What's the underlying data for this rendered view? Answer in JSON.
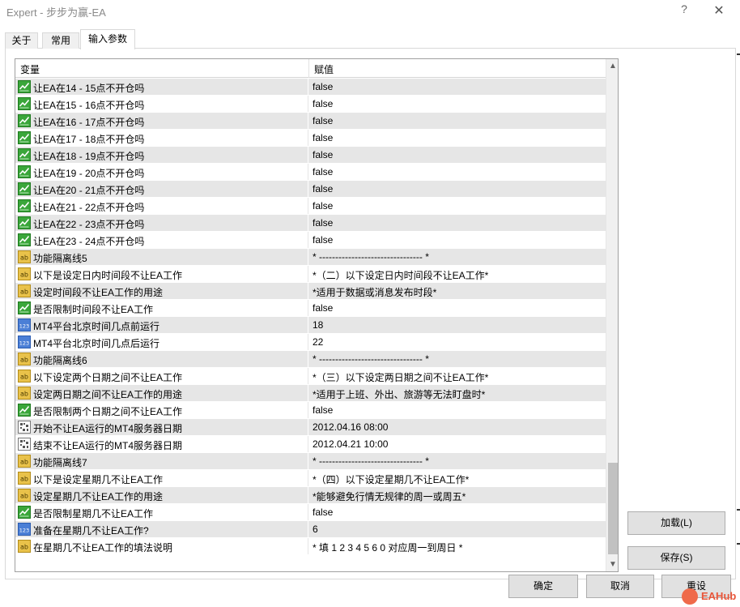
{
  "window": {
    "title": "Expert - 步步为赢-EA",
    "help": "?",
    "close": "✕"
  },
  "tabs": [
    {
      "label": "关于",
      "active": false
    },
    {
      "label": "常用",
      "active": false
    },
    {
      "label": "输入参数",
      "active": true
    }
  ],
  "grid": {
    "col_variable": "变量",
    "col_value": "赋值",
    "rows": [
      {
        "icon": "bool-icon",
        "name": "让EA在14 - 15点不开仓吗",
        "value": "false"
      },
      {
        "icon": "bool-icon",
        "name": "让EA在15 - 16点不开仓吗",
        "value": "false"
      },
      {
        "icon": "bool-icon",
        "name": "让EA在16 - 17点不开仓吗",
        "value": "false"
      },
      {
        "icon": "bool-icon",
        "name": "让EA在17 - 18点不开仓吗",
        "value": "false"
      },
      {
        "icon": "bool-icon",
        "name": "让EA在18 - 19点不开仓吗",
        "value": "false"
      },
      {
        "icon": "bool-icon",
        "name": "让EA在19 - 20点不开仓吗",
        "value": "false"
      },
      {
        "icon": "bool-icon",
        "name": "让EA在20 - 21点不开仓吗",
        "value": "false"
      },
      {
        "icon": "bool-icon",
        "name": "让EA在21 - 22点不开仓吗",
        "value": "false"
      },
      {
        "icon": "bool-icon",
        "name": "让EA在22 - 23点不开仓吗",
        "value": "false"
      },
      {
        "icon": "bool-icon",
        "name": "让EA在23 - 24点不开仓吗",
        "value": "false"
      },
      {
        "icon": "string-icon",
        "name": "功能隔离线5",
        "value": "* -------------------------------- *"
      },
      {
        "icon": "string-icon",
        "name": "以下是设定日内时间段不让EA工作",
        "value": "*（二）以下设定日内时间段不让EA工作*"
      },
      {
        "icon": "string-icon",
        "name": "设定时间段不让EA工作的用途",
        "value": "*适用于数据或消息发布时段*"
      },
      {
        "icon": "bool-icon",
        "name": "是否限制时间段不让EA工作",
        "value": "false"
      },
      {
        "icon": "int-icon",
        "name": "MT4平台北京时间几点前运行",
        "value": "18"
      },
      {
        "icon": "int-icon",
        "name": "MT4平台北京时间几点后运行",
        "value": "22"
      },
      {
        "icon": "string-icon",
        "name": "功能隔离线6",
        "value": "* -------------------------------- *"
      },
      {
        "icon": "string-icon",
        "name": "以下设定两个日期之间不让EA工作",
        "value": "*（三）以下设定两日期之间不让EA工作*"
      },
      {
        "icon": "string-icon",
        "name": "设定两日期之间不让EA工作的用途",
        "value": "*适用于上班、外出、旅游等无法盯盘时*"
      },
      {
        "icon": "bool-icon",
        "name": "是否限制两个日期之间不让EA工作",
        "value": "false"
      },
      {
        "icon": "datetime-icon",
        "name": "开始不让EA运行的MT4服务器日期",
        "value": "2012.04.16 08:00"
      },
      {
        "icon": "datetime-icon",
        "name": "结束不让EA运行的MT4服务器日期",
        "value": "2012.04.21 10:00"
      },
      {
        "icon": "string-icon",
        "name": "功能隔离线7",
        "value": "* -------------------------------- *"
      },
      {
        "icon": "string-icon",
        "name": "以下是设定星期几不让EA工作",
        "value": "*（四）以下设定星期几不让EA工作*"
      },
      {
        "icon": "string-icon",
        "name": "设定星期几不让EA工作的用途",
        "value": "*能够避免行情无规律的周一或周五*"
      },
      {
        "icon": "bool-icon",
        "name": "是否限制星期几不让EA工作",
        "value": "false"
      },
      {
        "icon": "int-icon",
        "name": "准备在星期几不让EA工作?",
        "value": "6"
      },
      {
        "icon": "string-icon",
        "name": "在星期几不让EA工作的填法说明",
        "value": "* 填 1 2 3 4 5 6 0 对应周一到周日 *"
      }
    ]
  },
  "buttons": {
    "load": "加载(L)",
    "save": "保存(S)",
    "ok": "确定",
    "cancel": "取消",
    "reset": "重设"
  },
  "watermark": {
    "text": "EAHub"
  }
}
